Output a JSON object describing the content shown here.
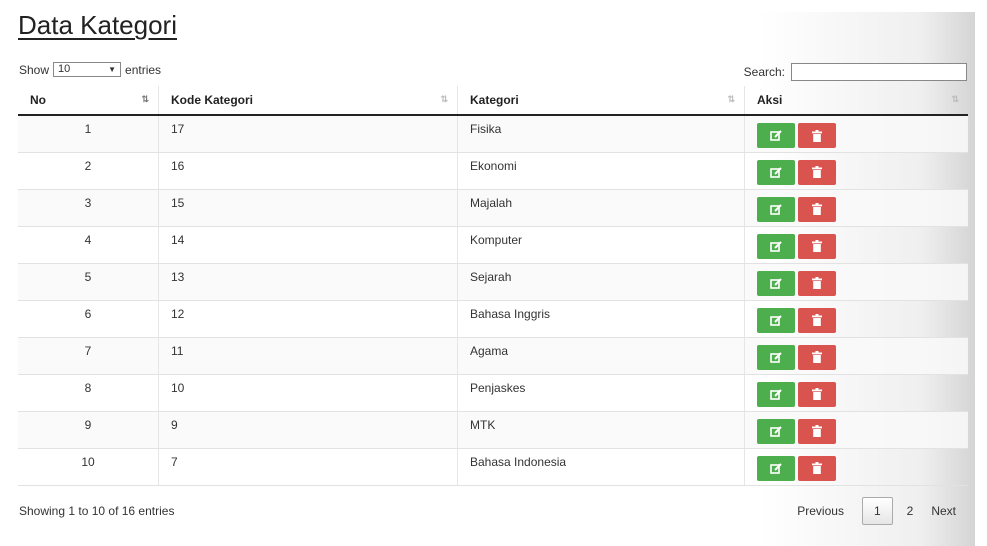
{
  "page": {
    "title": "Data Kategori"
  },
  "length_control": {
    "show_label": "Show",
    "selected": "10",
    "entries_label": "entries"
  },
  "search": {
    "label": "Search:",
    "value": "",
    "placeholder": ""
  },
  "table": {
    "headers": [
      "No",
      "Kode Kategori",
      "Kategori",
      "Aksi"
    ],
    "rows": [
      {
        "no": "1",
        "kode": "17",
        "kategori": "Fisika"
      },
      {
        "no": "2",
        "kode": "16",
        "kategori": "Ekonomi"
      },
      {
        "no": "3",
        "kode": "15",
        "kategori": "Majalah"
      },
      {
        "no": "4",
        "kode": "14",
        "kategori": "Komputer"
      },
      {
        "no": "5",
        "kode": "13",
        "kategori": "Sejarah"
      },
      {
        "no": "6",
        "kode": "12",
        "kategori": "Bahasa Inggris"
      },
      {
        "no": "7",
        "kode": "11",
        "kategori": "Agama"
      },
      {
        "no": "8",
        "kode": "10",
        "kategori": "Penjaskes"
      },
      {
        "no": "9",
        "kode": "9",
        "kategori": "MTK"
      },
      {
        "no": "10",
        "kode": "7",
        "kategori": "Bahasa Indonesia"
      }
    ],
    "action_icons": [
      "edit-icon",
      "trash-icon"
    ]
  },
  "info": {
    "text": "Showing 1 to 10 of 16 entries"
  },
  "pagination": {
    "previous": "Previous",
    "pages": [
      "1",
      "2"
    ],
    "current": "1",
    "next": "Next"
  },
  "colors": {
    "edit_button": "#4cae4c",
    "delete_button": "#d9534f"
  }
}
